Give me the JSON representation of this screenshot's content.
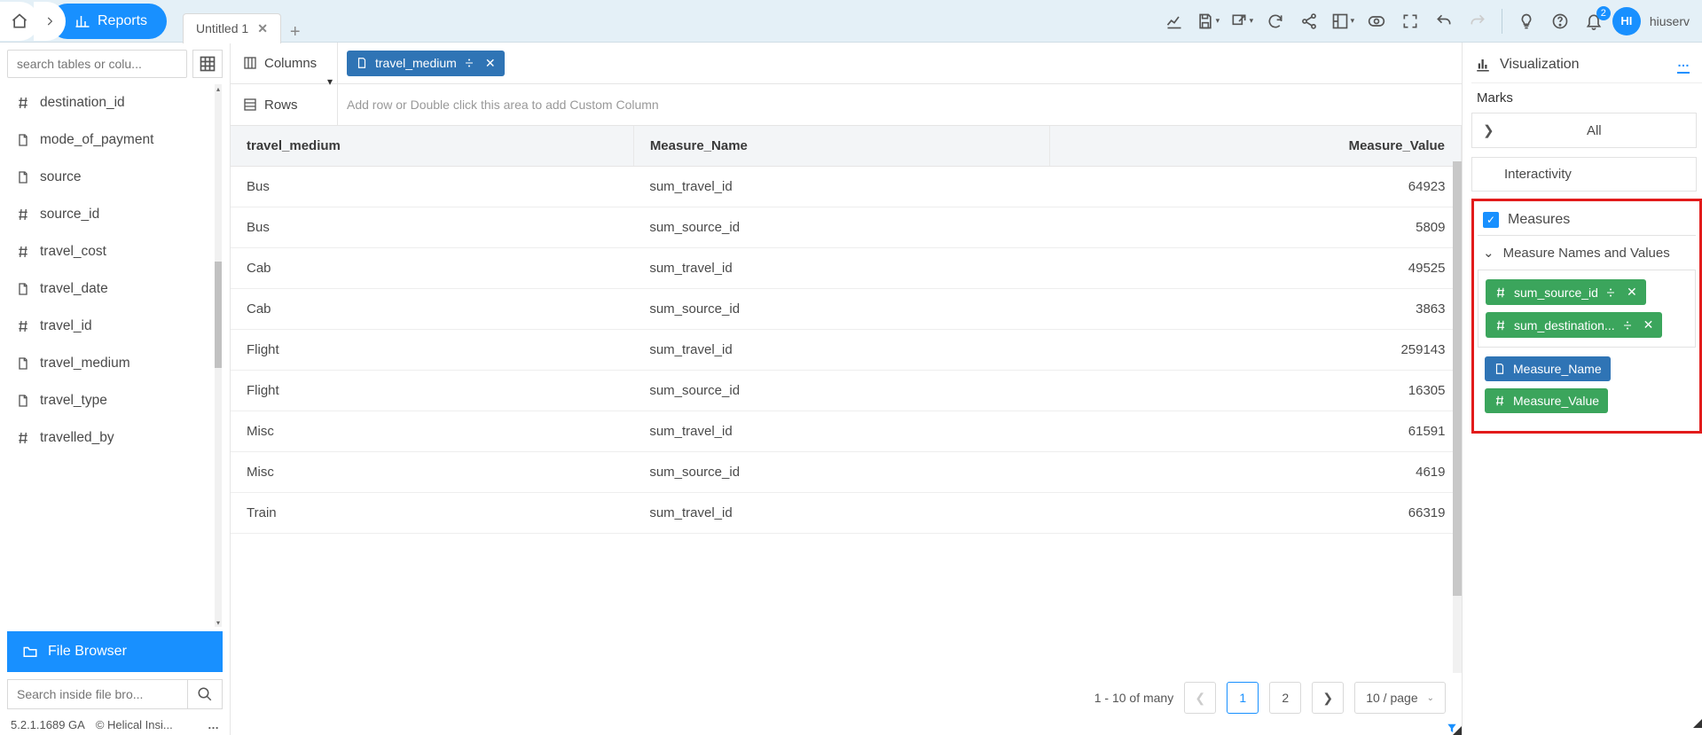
{
  "top": {
    "reports_label": "Reports",
    "tab_label": "Untitled 1",
    "notif_count": "2",
    "avatar_initials": "HI",
    "username": "hiuserv"
  },
  "sidebar": {
    "search_placeholder": "search tables or colu...",
    "cols": [
      {
        "icon": "hash",
        "label": "destination_id"
      },
      {
        "icon": "doc",
        "label": "mode_of_payment"
      },
      {
        "icon": "doc",
        "label": "source"
      },
      {
        "icon": "hash",
        "label": "source_id"
      },
      {
        "icon": "hash",
        "label": "travel_cost"
      },
      {
        "icon": "doc",
        "label": "travel_date"
      },
      {
        "icon": "hash",
        "label": "travel_id"
      },
      {
        "icon": "doc",
        "label": "travel_medium"
      },
      {
        "icon": "doc",
        "label": "travel_type"
      },
      {
        "icon": "hash",
        "label": "travelled_by"
      }
    ],
    "file_browser_label": "File Browser",
    "fb_search_placeholder": "Search inside file bro...",
    "version": "5.2.1.1689 GA",
    "credit": "Helical Insi..."
  },
  "shelves": {
    "columns_label": "Columns",
    "rows_label": "Rows",
    "col_pill": "travel_medium",
    "rows_placeholder": "Add row or Double click this area to add Custom Column"
  },
  "table": {
    "headers": [
      "travel_medium",
      "Measure_Name",
      "Measure_Value"
    ],
    "rows": [
      [
        "Bus",
        "sum_travel_id",
        "64923"
      ],
      [
        "Bus",
        "sum_source_id",
        "5809"
      ],
      [
        "Cab",
        "sum_travel_id",
        "49525"
      ],
      [
        "Cab",
        "sum_source_id",
        "3863"
      ],
      [
        "Flight",
        "sum_travel_id",
        "259143"
      ],
      [
        "Flight",
        "sum_source_id",
        "16305"
      ],
      [
        "Misc",
        "sum_travel_id",
        "61591"
      ],
      [
        "Misc",
        "sum_source_id",
        "4619"
      ],
      [
        "Train",
        "sum_travel_id",
        "66319"
      ]
    ]
  },
  "pager": {
    "summary": "1 - 10 of many",
    "page1": "1",
    "page2": "2",
    "size": "10 / page"
  },
  "right": {
    "viz_label": "Visualization",
    "marks_label": "Marks",
    "all_label": "All",
    "interactivity_label": "Interactivity",
    "measures_label": "Measures",
    "mnv_label": "Measure Names and Values",
    "pill_sum_source": "sum_source_id",
    "pill_sum_dest": "sum_destination...",
    "pill_mname": "Measure_Name",
    "pill_mvalue": "Measure_Value"
  }
}
